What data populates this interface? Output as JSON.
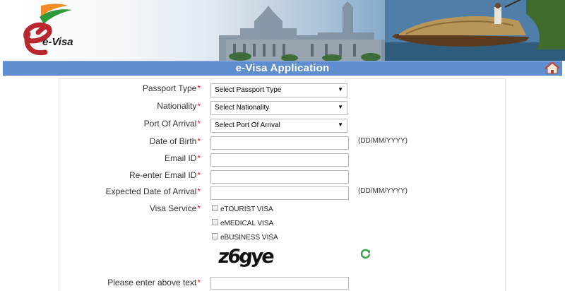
{
  "header": {
    "logo_text": "e-Visa",
    "title": "e-Visa Application"
  },
  "form": {
    "passport_type": {
      "label": "Passport Type",
      "value": "Select Passport Type"
    },
    "nationality": {
      "label": "Nationality",
      "value": "Select Nationality"
    },
    "port_of_arrival": {
      "label": "Port Of Arrival",
      "value": "Select Port Of Arrival"
    },
    "date_of_birth": {
      "label": "Date of Birth",
      "value": "",
      "hint": "(DD/MM/YYYY)"
    },
    "email": {
      "label": "Email ID",
      "value": ""
    },
    "reenter_email": {
      "label": "Re-enter Email ID",
      "value": ""
    },
    "expected_arrival": {
      "label": "Expected Date of Arrival",
      "value": "",
      "hint": "(DD/MM/YYYY)"
    },
    "visa_service": {
      "label": "Visa Service",
      "options": [
        "eTOURIST VISA",
        "eMEDICAL VISA",
        "eBUSINESS VISA"
      ]
    },
    "captcha": {
      "text": "z6gye",
      "label": "Please enter above text",
      "value": ""
    },
    "required_marker": "*"
  },
  "colors": {
    "title_bar": "#5e8ed0",
    "required": "#e0202a",
    "refresh": "#3aa54a"
  },
  "icons": [
    "evisa-logo",
    "home-icon",
    "refresh-icon",
    "dropdown-caret-icon",
    "checkbox-icon"
  ]
}
